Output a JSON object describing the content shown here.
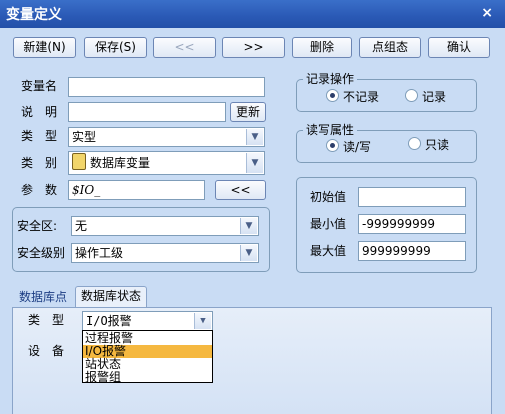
{
  "window": {
    "title": "变量定义",
    "close": "×"
  },
  "toolbar": {
    "new": "新建(N)",
    "save": "保存(S)",
    "prev": "<<",
    "next": ">>",
    "delete": "删除",
    "point_config": "点组态",
    "ok": "确认"
  },
  "form": {
    "name": {
      "label": "变量名",
      "value": ""
    },
    "desc": {
      "label": "说　明",
      "value": "",
      "update_btn": "更新"
    },
    "type": {
      "label": "类　型",
      "value": "实型"
    },
    "category": {
      "label": "类　别",
      "value": "数据库变量"
    },
    "param": {
      "label": "参　数",
      "value": "$IO_",
      "btn": "<<"
    }
  },
  "security": {
    "zone": {
      "label": "安全区:",
      "value": "无"
    },
    "level": {
      "label": "安全级别",
      "value": "操作工级"
    }
  },
  "record": {
    "title": "记录操作",
    "options": [
      "不记录",
      "记录"
    ],
    "selected": 0
  },
  "rw": {
    "title": "读写属性",
    "options": [
      "读/写",
      "只读"
    ],
    "selected": 0
  },
  "values": {
    "initial": {
      "label": "初始值",
      "value": ""
    },
    "min": {
      "label": "最小值",
      "value": "-999999999"
    },
    "max": {
      "label": "最大值",
      "value": "999999999"
    }
  },
  "tabs": [
    {
      "label": "数据库点"
    },
    {
      "label": "数据库状态"
    }
  ],
  "status": {
    "type": {
      "label": "类　型",
      "value": "I/O报警"
    },
    "device": {
      "label": "设　备"
    },
    "dropdown": [
      "过程报警",
      "I/O报警",
      "站状态",
      "报警组"
    ],
    "dropdown_selected": 1
  },
  "colors": {
    "titlebar": "#2a59b5",
    "background": "#c9dcf4",
    "highlight": "#f5b840"
  }
}
